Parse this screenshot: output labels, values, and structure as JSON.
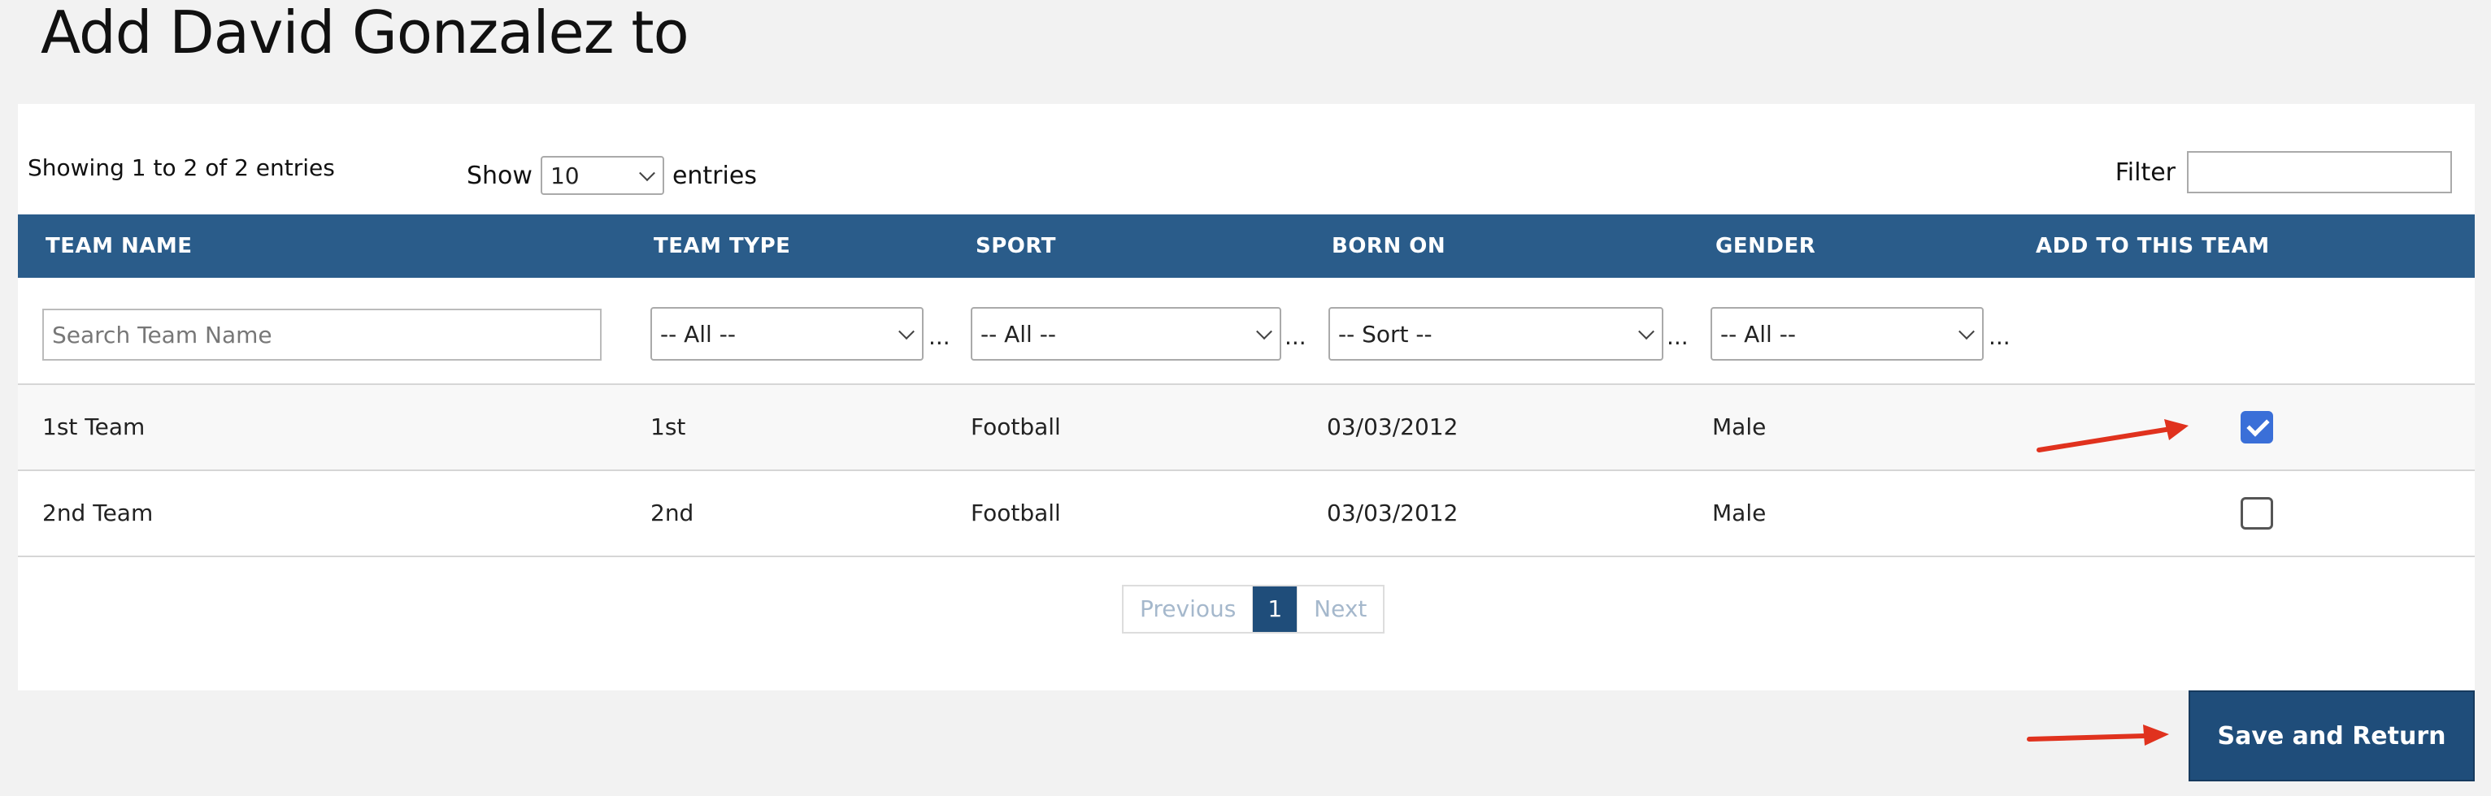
{
  "page": {
    "title": "Add David Gonzalez to"
  },
  "table_controls": {
    "info": "Showing 1 to 2 of 2 entries",
    "show_label": "Show",
    "page_length": "10",
    "entries_label": "entries",
    "filter_label": "Filter",
    "filter_value": ""
  },
  "columns": [
    "TEAM NAME",
    "TEAM TYPE",
    "SPORT",
    "BORN ON",
    "GENDER",
    "ADD TO THIS TEAM"
  ],
  "column_filters": {
    "team_name_placeholder": "Search Team Name",
    "team_type": "-- All --",
    "sport": "-- All --",
    "born_on": "-- Sort --",
    "gender": "-- All --",
    "ellipsis": "..."
  },
  "rows": [
    {
      "team_name": "1st Team",
      "team_type": "1st",
      "sport": "Football",
      "born_on": "03/03/2012",
      "gender": "Male",
      "added": true
    },
    {
      "team_name": "2nd Team",
      "team_type": "2nd",
      "sport": "Football",
      "born_on": "03/03/2012",
      "gender": "Male",
      "added": false
    }
  ],
  "pagination": {
    "previous": "Previous",
    "current": "1",
    "next": "Next"
  },
  "actions": {
    "save_label": "Save and Return"
  },
  "colors": {
    "header_bg": "#2a5c8a",
    "button_bg": "#1f4d7a",
    "checkbox_checked": "#3a6fd8",
    "annotation_arrow": "#e0321e"
  }
}
